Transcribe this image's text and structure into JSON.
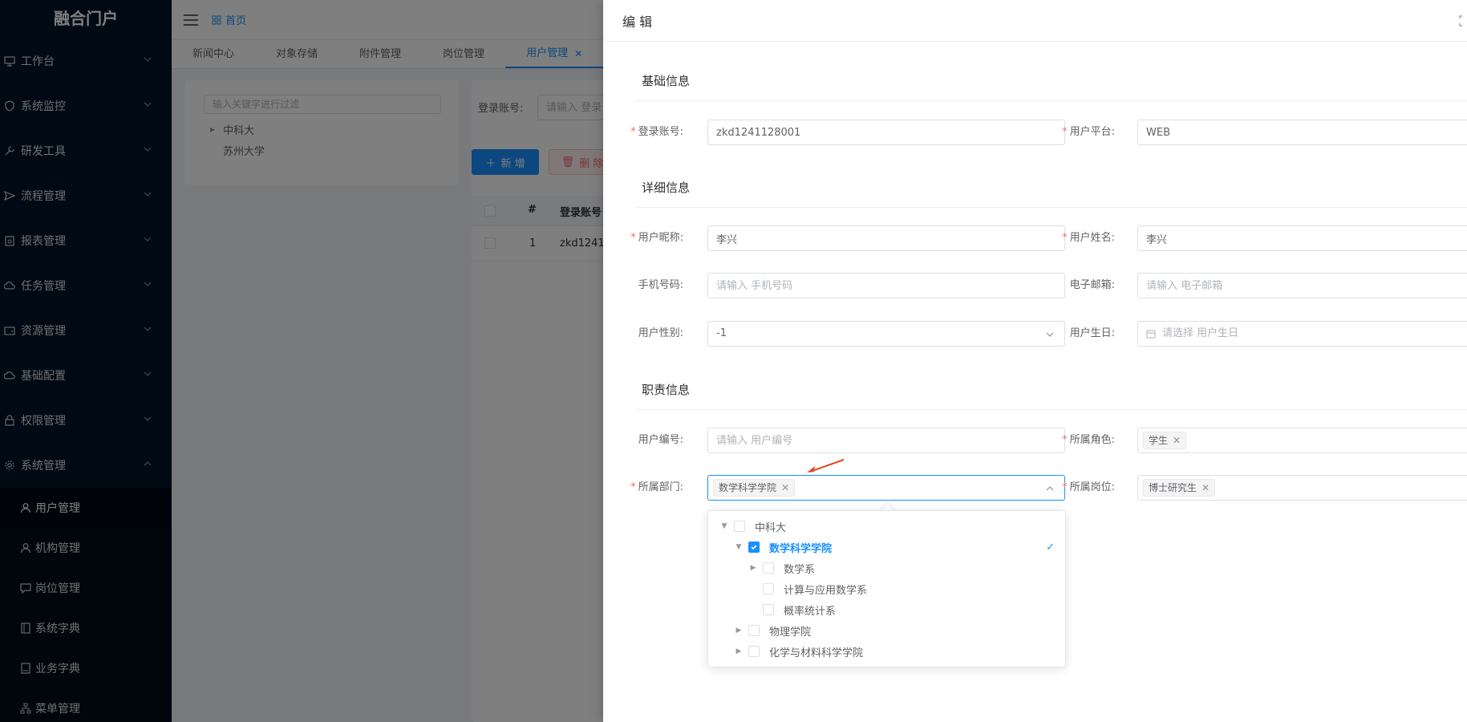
{
  "app": {
    "logo": "融合门户"
  },
  "sidebar": {
    "items": [
      {
        "label": "工作台",
        "icon": "monitor-icon"
      },
      {
        "label": "系统监控",
        "icon": "shield-icon"
      },
      {
        "label": "研发工具",
        "icon": "wrench-icon"
      },
      {
        "label": "流程管理",
        "icon": "send-icon"
      },
      {
        "label": "报表管理",
        "icon": "report-icon"
      },
      {
        "label": "任务管理",
        "icon": "cloud-icon"
      },
      {
        "label": "资源管理",
        "icon": "wallet-icon"
      },
      {
        "label": "基础配置",
        "icon": "cloud-config-icon"
      },
      {
        "label": "权限管理",
        "icon": "lock-icon"
      },
      {
        "label": "系统管理",
        "icon": "gear-icon"
      }
    ],
    "sub_items": [
      {
        "label": "用户管理",
        "icon": "user-icon"
      },
      {
        "label": "机构管理",
        "icon": "org-user-icon"
      },
      {
        "label": "岗位管理",
        "icon": "chat-icon"
      },
      {
        "label": "系统字典",
        "icon": "book-icon"
      },
      {
        "label": "业务字典",
        "icon": "book-open-icon"
      },
      {
        "label": "菜单管理",
        "icon": "sitemap-icon"
      }
    ]
  },
  "header": {
    "home": "首页"
  },
  "tabs": [
    "新闻中心",
    "对象存储",
    "附件管理",
    "岗位管理",
    "用户管理"
  ],
  "org_tree": {
    "filter_placeholder": "输入关键字进行过滤",
    "nodes": [
      "中科大",
      "苏州大学"
    ]
  },
  "user_table": {
    "search_label": "登录账号:",
    "search_placeholder": "请输入 登录",
    "add_button": "新 增",
    "delete_button": "删 除",
    "columns": [
      "#",
      "登录账号"
    ],
    "rows": [
      {
        "index": "1",
        "account": "zkd1241"
      }
    ]
  },
  "drawer": {
    "title": "编 辑",
    "sections": {
      "basic": "基础信息",
      "detail": "详细信息",
      "duty": "职责信息"
    },
    "fields": {
      "account": {
        "label": "登录账号:",
        "value": "zkd1241128001"
      },
      "platform": {
        "label": "用户平台:",
        "value": "WEB"
      },
      "nickname": {
        "label": "用户昵称:",
        "value": "李兴"
      },
      "realname": {
        "label": "用户姓名:",
        "value": "李兴"
      },
      "phone": {
        "label": "手机号码:",
        "placeholder": "请输入 手机号码"
      },
      "email": {
        "label": "电子邮箱:",
        "placeholder": "请输入 电子邮箱"
      },
      "gender": {
        "label": "用户性别:",
        "value": "-1"
      },
      "birthday": {
        "label": "用户生日:",
        "placeholder": "请选择 用户生日"
      },
      "code": {
        "label": "用户编号:",
        "placeholder": "请输入 用户编号"
      },
      "role": {
        "label": "所属角色:",
        "tag": "学生"
      },
      "dept": {
        "label": "所属部门:",
        "tag": "数学科学学院"
      },
      "post": {
        "label": "所属岗位:",
        "tag": "博士研究生"
      }
    }
  },
  "dept_tree": {
    "nodes": [
      {
        "label": "中科大",
        "level": 0,
        "expanded": true,
        "checked": false,
        "has_children": true
      },
      {
        "label": "数学科学学院",
        "level": 1,
        "expanded": true,
        "checked": true,
        "has_children": true
      },
      {
        "label": "数学系",
        "level": 2,
        "expanded": false,
        "checked": false,
        "has_children": true
      },
      {
        "label": "计算与应用数学系",
        "level": 2,
        "expanded": false,
        "checked": false,
        "has_children": false
      },
      {
        "label": "概率统计系",
        "level": 2,
        "expanded": false,
        "checked": false,
        "has_children": false
      },
      {
        "label": "物理学院",
        "level": 1,
        "expanded": false,
        "checked": false,
        "has_children": true
      },
      {
        "label": "化学与材料科学学院",
        "level": 1,
        "expanded": false,
        "checked": false,
        "has_children": true
      }
    ]
  },
  "colors": {
    "primary": "#1890ff",
    "danger": "#f56c6c",
    "sidebar": "#001529",
    "annotation_arrow": "#e04a1f"
  }
}
